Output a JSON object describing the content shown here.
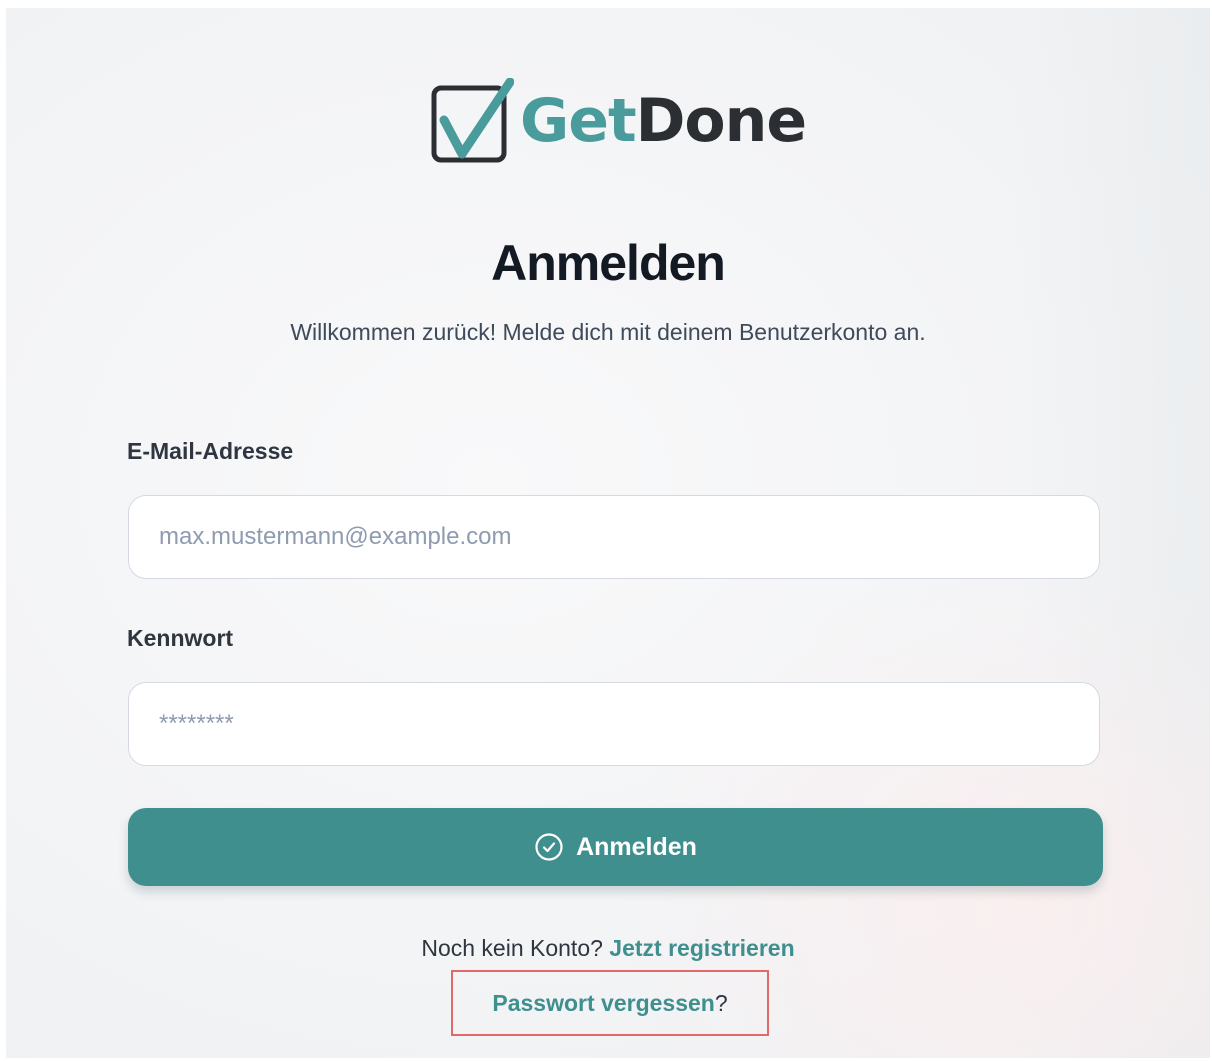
{
  "brand": {
    "name_part1": "Get",
    "name_part2": "Done",
    "logo_icon": "checkbox-check-icon",
    "colors": {
      "teal": "#4a9b9b",
      "dark": "#2b2f33"
    }
  },
  "login": {
    "title": "Anmelden",
    "subtitle": "Willkommen zurück! Melde dich mit deinem Benutzerkonto an.",
    "email": {
      "label": "E-Mail-Adresse",
      "placeholder": "max.mustermann@example.com",
      "value": ""
    },
    "password": {
      "label": "Kennwort",
      "placeholder": "********",
      "value": ""
    },
    "submit": {
      "label": "Anmelden",
      "icon": "check-circle-icon",
      "color": "#3f8f8f"
    },
    "register": {
      "prompt": "Noch kein Konto? ",
      "link_label": "Jetzt registrieren"
    },
    "forgot": {
      "link_label": "Passwort vergessen",
      "suffix": "?",
      "highlight_color": "#e06a6a"
    }
  }
}
